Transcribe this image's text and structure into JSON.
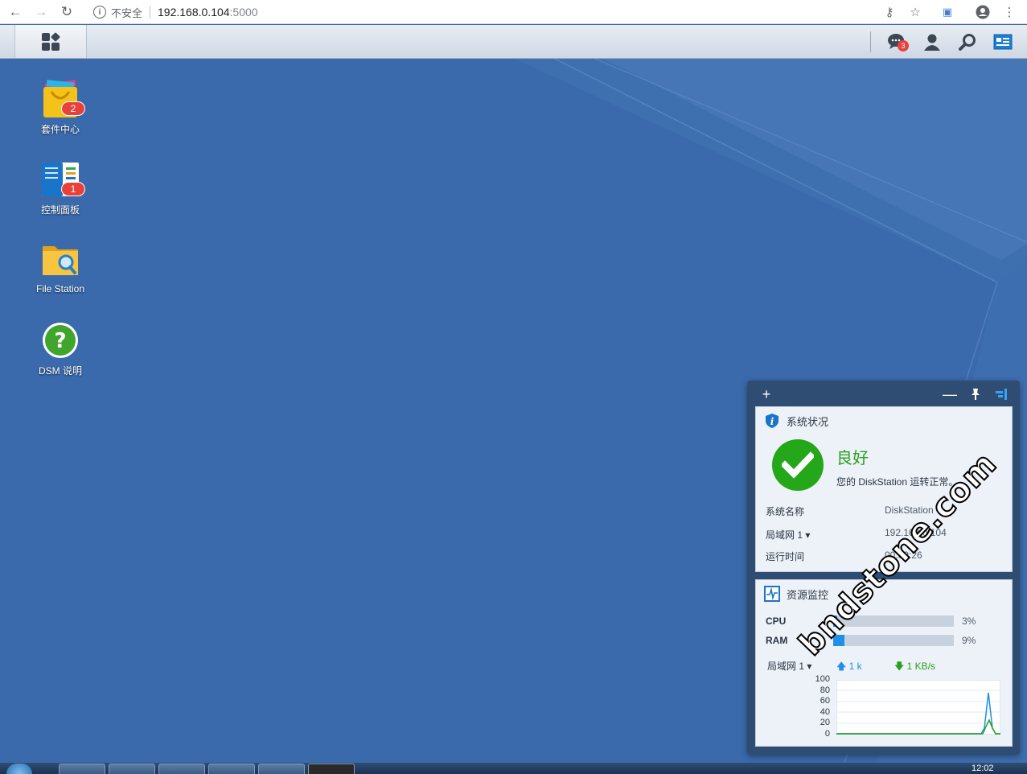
{
  "browser": {
    "insecure_label": "不安全",
    "url_host": "192.168.0.104",
    "url_port": ":5000",
    "icons": [
      "back-icon",
      "forward-icon",
      "reload-icon",
      "info-icon",
      "key-icon",
      "star-icon",
      "cast-icon",
      "account-icon",
      "menu-icon"
    ]
  },
  "dsm_taskbar": {
    "notification_count": "3",
    "icons": [
      "main-menu-icon",
      "notifications-icon",
      "user-icon",
      "search-icon",
      "widgets-icon"
    ]
  },
  "desktop_icons": [
    {
      "label": "套件中心",
      "badge": "2",
      "icon": "package-center-icon"
    },
    {
      "label": "控制面板",
      "badge": "1",
      "icon": "control-panel-icon"
    },
    {
      "label": "File Station",
      "badge": "",
      "icon": "file-station-icon"
    },
    {
      "label": "DSM 说明",
      "badge": "",
      "icon": "dsm-help-icon"
    }
  ],
  "widgets": {
    "system_status": {
      "title": "系统状况",
      "status": "良好",
      "message": "您的 DiskStation 运转正常。",
      "rows": [
        {
          "key": "系统名称",
          "value": "DiskStation"
        },
        {
          "key": "局域网 1 ▾",
          "value": "192.168.0.104"
        },
        {
          "key": "运行时间",
          "value": "00:09:26"
        }
      ]
    },
    "resource_monitor": {
      "title": "资源监控",
      "cpu_label": "CPU",
      "cpu_value": "3%",
      "cpu_fraction": 0.03,
      "ram_label": "RAM",
      "ram_value": "9%",
      "ram_fraction": 0.09,
      "lan_label": "局域网 1 ▾",
      "upload": "1 k",
      "download": "1 KB/s",
      "chart_ticks": [
        "100",
        "80",
        "60",
        "40",
        "20",
        "0"
      ]
    }
  },
  "watermark": "bndstone.com",
  "windows_taskbar": {
    "clock": "12:02"
  },
  "colors": {
    "desktop": "#3a6aac",
    "status_ok": "#25a71a",
    "upload": "#1f8fe8",
    "download": "#27a01c"
  }
}
